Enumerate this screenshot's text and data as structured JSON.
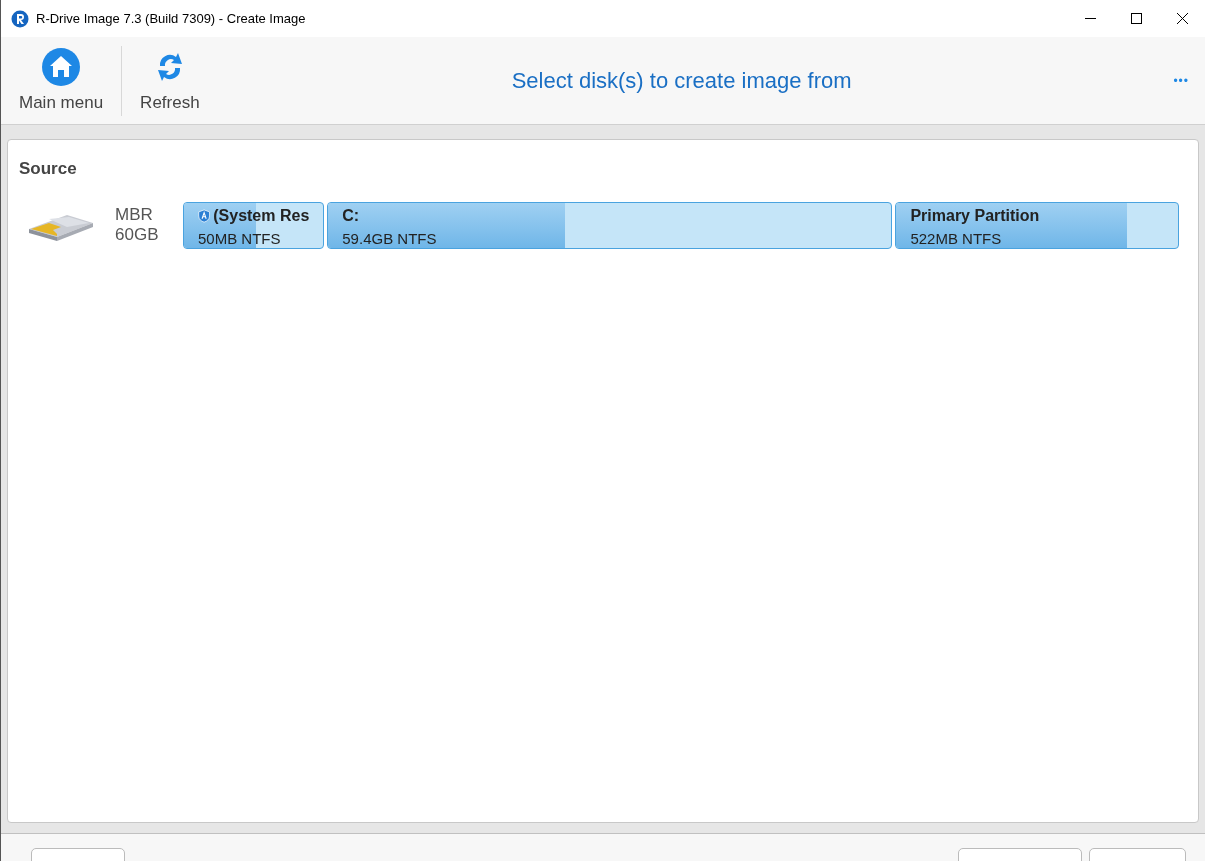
{
  "window": {
    "title": "R-Drive Image 7.3 (Build 7309) - Create Image"
  },
  "toolbar": {
    "buttons": [
      {
        "kind": "home",
        "label": "Main menu"
      },
      {
        "kind": "refresh",
        "label": "Refresh"
      }
    ],
    "heading": "Select disk(s) to create image from",
    "more": "•••"
  },
  "source": {
    "title": "Source",
    "disk": {
      "scheme": "MBR",
      "size": "60GB"
    },
    "partitions": [
      {
        "name": "(System Res",
        "info": "50MB NTFS",
        "level": 0.52,
        "system": true
      },
      {
        "name": "C:",
        "info": "59.4GB NTFS",
        "level": 0.42,
        "system": false
      },
      {
        "name": "Primary Partition",
        "info": "522MB NTFS",
        "level": 0.82,
        "system": false
      }
    ]
  }
}
